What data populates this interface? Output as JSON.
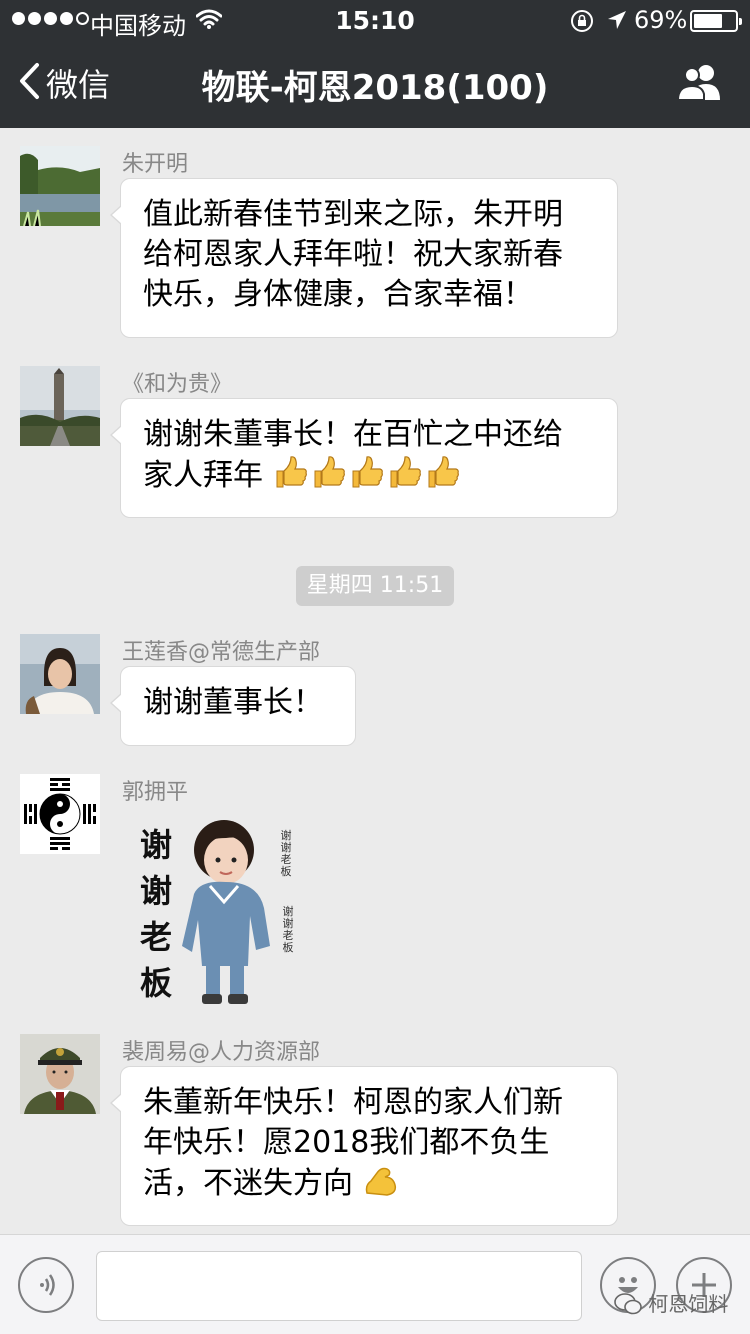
{
  "status_bar": {
    "carrier": "中国移动",
    "time": "15:10",
    "battery": "69%",
    "battery_level": 0.69,
    "signal_bars": 4,
    "icons": [
      "signal-dots-icon",
      "wifi-icon",
      "rotation-lock-icon",
      "location-arrow-icon",
      "battery-icon"
    ]
  },
  "nav": {
    "back_label": "微信",
    "title": "物联-柯恩2018(100)",
    "icons": [
      "chevron-left-icon",
      "group-members-icon"
    ]
  },
  "messages": [
    {
      "sender": "朱开明",
      "avatar": "lake-avatar",
      "lines": [
        "值此新春佳节到来之际，朱开明",
        "给柯恩家人拜年啦！祝大家新春",
        "快乐，身体健康，合家幸福！"
      ]
    },
    {
      "sender": "《和为贵》",
      "avatar": "tower-avatar",
      "lines": [
        "谢谢朱董事长！在百忙之中还给",
        "家人拜年"
      ],
      "emoji": [
        "thumbs-up-icon",
        "thumbs-up-icon",
        "thumbs-up-icon",
        "thumbs-up-icon",
        "thumbs-up-icon"
      ]
    },
    {
      "sender": "王莲香@常德生产部",
      "avatar": "woman-avatar",
      "lines": [
        "谢谢董事长！"
      ]
    },
    {
      "sender": "郭拥平",
      "avatar": "yin-yang-avatar",
      "sticker": {
        "big_text": [
          "谢",
          "谢",
          "老",
          "板"
        ],
        "small_text_1": "谢谢老板",
        "small_text_2": "谢谢老板"
      }
    },
    {
      "sender": "裴周易@人力资源部",
      "avatar": "soldier-avatar",
      "lines": [
        "朱董新年快乐！柯恩的家人们新",
        "年快乐！愿2018我们都不负生",
        "活，不迷失方向"
      ],
      "emoji": [
        "flexed-biceps-icon"
      ]
    }
  ],
  "timestamp": "星期四 11:51",
  "input_bar": {
    "icons": [
      "voice-icon",
      "emoji-face-icon",
      "plus-icon"
    ],
    "text_value": ""
  },
  "watermark": "柯恩饲料"
}
